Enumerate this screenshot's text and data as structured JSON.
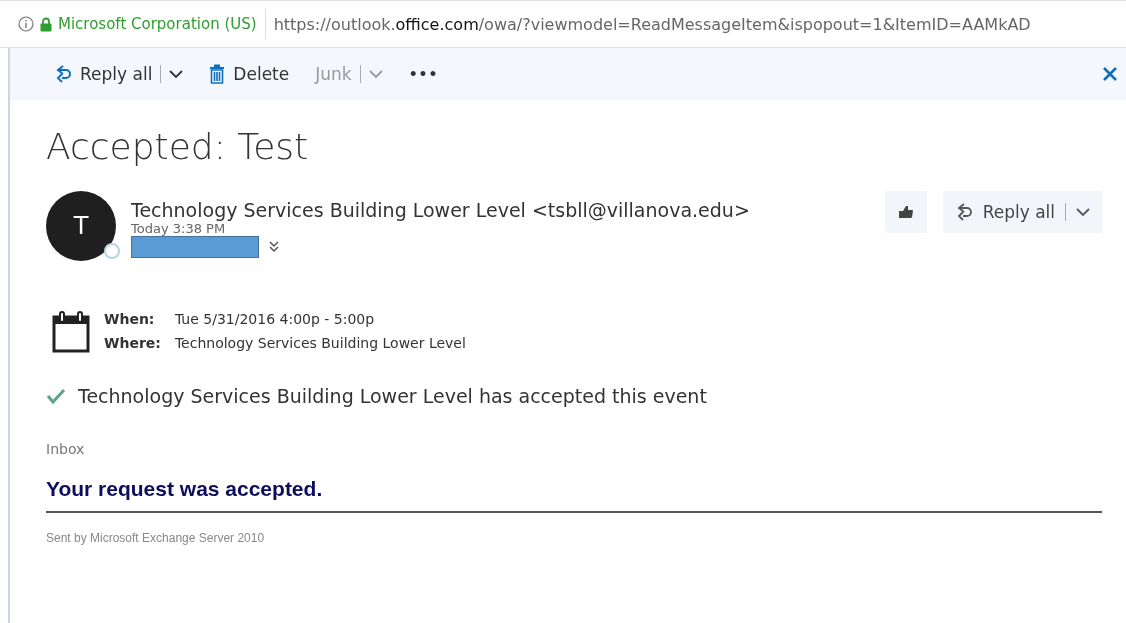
{
  "address_bar": {
    "site_identity": "Microsoft Corporation (US)",
    "url_prefix": "https://outlook.",
    "url_domain": "office.com",
    "url_rest": "/owa/?viewmodel=ReadMessageItem&ispopout=1&ItemID=AAMkAD"
  },
  "toolbar": {
    "buttons": [
      {
        "kind": "reply",
        "label": "Reply all",
        "disabled": false,
        "dropdown": true
      },
      {
        "kind": "delete",
        "label": "Delete",
        "disabled": false,
        "dropdown": false
      },
      {
        "kind": "plain",
        "label": "Junk",
        "disabled": true,
        "dropdown": true
      },
      {
        "kind": "more",
        "label": "•••",
        "disabled": false,
        "dropdown": false
      }
    ]
  },
  "message": {
    "subject": "Accepted: Test",
    "avatar_letter": "T",
    "sender": "Technology Services Building Lower Level <tsbll@villanova.edu>",
    "time": "Today 3:38 PM",
    "reply_button": "Reply all",
    "meeting": [
      {
        "label": "When:",
        "value": "Tue 5/31/2016 4:00p - 5:00p"
      },
      {
        "label": "Where:",
        "value": "Technology Services Building Lower Level"
      }
    ],
    "response": "Technology Services Building Lower Level has accepted this event",
    "folder": "Inbox",
    "body_heading": "Your request was accepted.",
    "footer": "Sent by Microsoft Exchange Server 2010"
  }
}
